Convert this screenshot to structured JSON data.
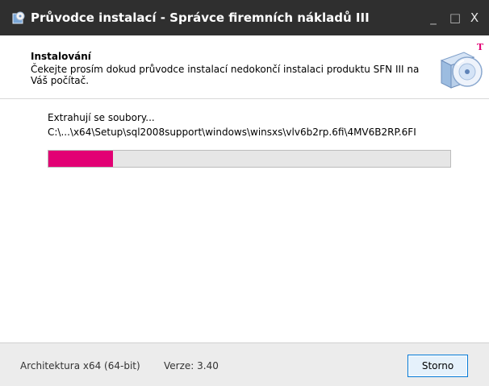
{
  "window": {
    "title": "Průvodce instalací - Správce firemních nákladů III",
    "app_icon": "installer-icon",
    "controls": {
      "minimize": "_",
      "maximize": "□",
      "close": "X"
    }
  },
  "header": {
    "title": "Instalování",
    "description": "Čekejte prosím dokud průvodce instalací nedokončí instalaci produktu SFN III na Váš počítač.",
    "brand_mark": "T",
    "icon": "cd-installer-icon"
  },
  "main": {
    "status": "Extrahují se soubory...",
    "current_file": "C:\\...\\x64\\Setup\\sql2008support\\windows\\winsxs\\vlv6b2rp.6fi\\4MV6B2RP.6FI",
    "progress": 0.16
  },
  "footer": {
    "architecture": "Architektura x64 (64-bit)",
    "version": "Verze: 3.40",
    "cancel_label": "Storno"
  },
  "colors": {
    "accent": "#e20074",
    "titlebar": "#2f2f2f",
    "button_border": "#0078d7"
  }
}
